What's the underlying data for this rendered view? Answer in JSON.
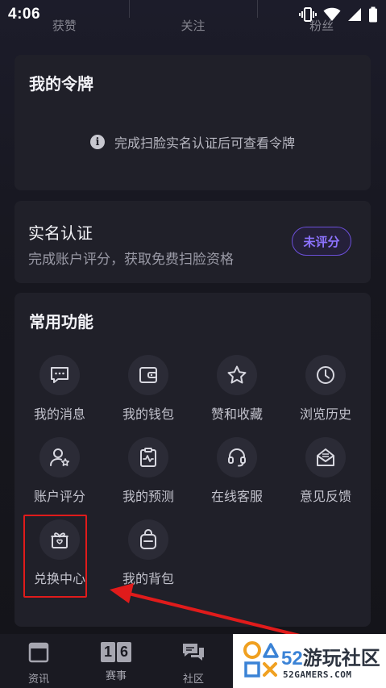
{
  "status_bar": {
    "time": "4:06"
  },
  "stats": [
    {
      "label": "获赞"
    },
    {
      "label": "关注"
    },
    {
      "label": "粉丝"
    }
  ],
  "token_card": {
    "title": "我的令牌",
    "notice": "完成扫脸实名认证后可查看令牌",
    "info_icon": "info-icon"
  },
  "verify_card": {
    "title": "实名认证",
    "subtitle": "完成账户评分，获取免费扫脸资格",
    "rate_button": "未评分"
  },
  "functions": {
    "title": "常用功能",
    "items": [
      {
        "label": "我的消息",
        "icon": "message-icon"
      },
      {
        "label": "我的钱包",
        "icon": "wallet-icon"
      },
      {
        "label": "赞和收藏",
        "icon": "star-icon"
      },
      {
        "label": "浏览历史",
        "icon": "clock-icon"
      },
      {
        "label": "账户评分",
        "icon": "user-star-icon"
      },
      {
        "label": "我的预测",
        "icon": "clipboard-chart-icon"
      },
      {
        "label": "在线客服",
        "icon": "headset-icon"
      },
      {
        "label": "意见反馈",
        "icon": "mail-icon"
      },
      {
        "label": "兑换中心",
        "icon": "gift-icon"
      },
      {
        "label": "我的背包",
        "icon": "backpack-icon"
      }
    ]
  },
  "bottom_nav": [
    {
      "label": "资讯",
      "icon": "news-icon"
    },
    {
      "label": "赛事",
      "icon": "match-icon",
      "badge_digits": [
        "1",
        "6"
      ]
    },
    {
      "label": "社区",
      "icon": "chat-icon"
    }
  ],
  "watermark": {
    "number": "52",
    "title": "游玩社区",
    "sub": "52GAMERS.COM"
  },
  "colors": {
    "background": "#17171f",
    "card": "#202029",
    "accent": "#8d73ff",
    "highlight": "#e01b1b"
  }
}
